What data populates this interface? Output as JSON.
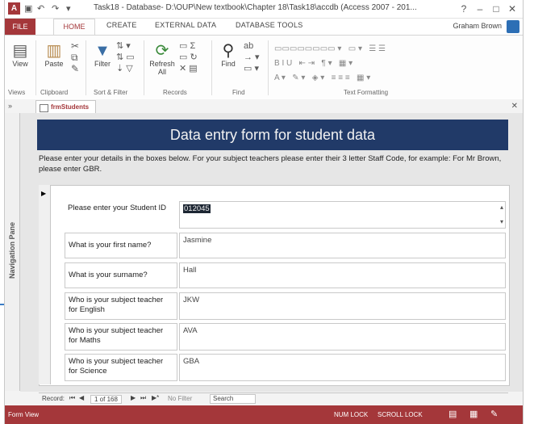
{
  "window": {
    "title": "Task18 - Database- D:\\OUP\\New textbook\\Chapter 18\\Task18\\accdb (Access 2007 - 201...",
    "help": "?",
    "minimize": "–",
    "restore": "□",
    "close": "✕"
  },
  "ribbon": {
    "tabs": [
      "FILE",
      "HOME",
      "CREATE",
      "EXTERNAL DATA",
      "DATABASE TOOLS"
    ],
    "user": "Graham Brown",
    "buttons": {
      "view": "View",
      "paste": "Paste",
      "filter": "Filter",
      "refresh": "Refresh All",
      "find": "Find"
    },
    "groups": [
      "Views",
      "Clipboard",
      "Sort & Filter",
      "Records",
      "Find",
      "Text Formatting"
    ]
  },
  "document": {
    "tab": "frmStudents",
    "nav_pane": "Navigation Pane"
  },
  "form": {
    "header": "Data entry form for student data",
    "instructions": "Please enter your details in the boxes below. For your subject teachers please enter their 3 letter Staff Code, for example: For Mr Brown, please enter GBR.",
    "fields": [
      {
        "label": "Please enter your Student ID",
        "value": "012045"
      },
      {
        "label": "What is your first name?",
        "value": "Jasmine"
      },
      {
        "label": "What is your surname?",
        "value": "Hall"
      },
      {
        "label": "Who is your subject teacher for English",
        "value": "JKW"
      },
      {
        "label": "Who is your subject teacher for Maths",
        "value": "AVA"
      },
      {
        "label": "Who is your subject teacher for Science",
        "value": "GBA"
      }
    ]
  },
  "record_nav": {
    "record_label": "Record:",
    "position": "1 of 168",
    "filter": "No Filter",
    "search": "Search"
  },
  "status": {
    "left": "Form View",
    "num_lock": "NUM LOCK",
    "scroll_lock": "SCROLL LOCK"
  },
  "colors": {
    "access_accent": "#a4373a",
    "header_bg": "#213a68",
    "arrow": "#3a7cc4"
  }
}
